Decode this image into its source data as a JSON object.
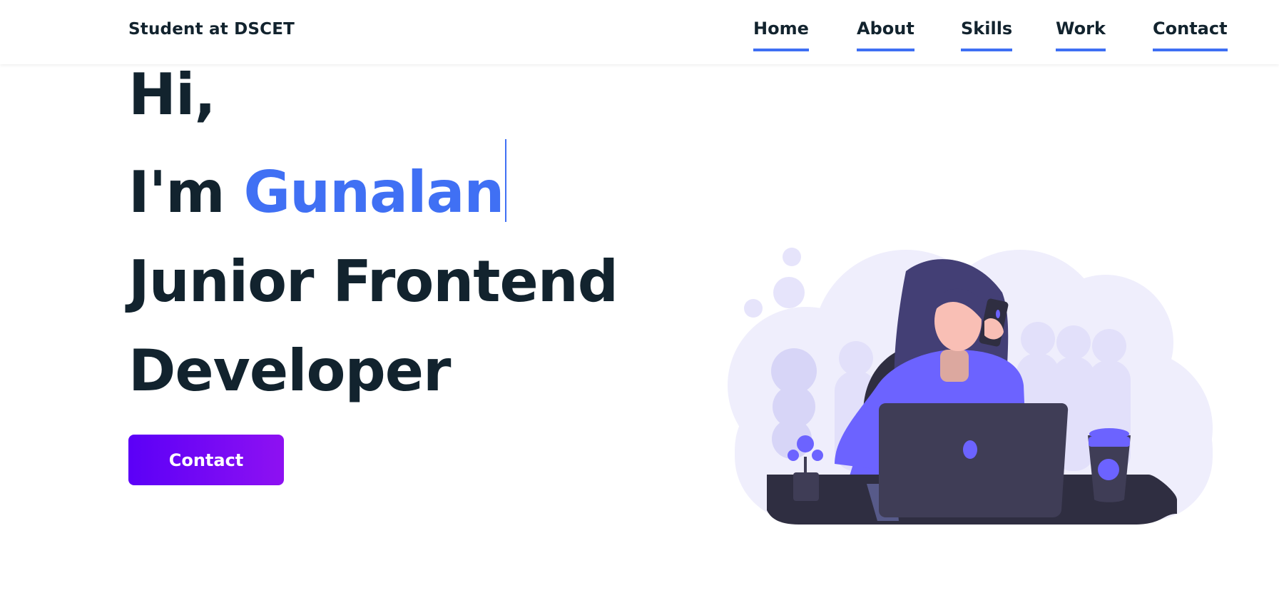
{
  "header": {
    "brand": "Student at DSCET",
    "nav": [
      {
        "id": "home",
        "label": "Home"
      },
      {
        "id": "about",
        "label": "About"
      },
      {
        "id": "skills",
        "label": "Skills"
      },
      {
        "id": "work",
        "label": "Work"
      },
      {
        "id": "contact",
        "label": "Contact"
      }
    ]
  },
  "hero": {
    "greeting": "Hi,",
    "intro_prefix": "I'm ",
    "name": "Gunalan",
    "role_line1": "Junior Frontend",
    "role_line2": "Developer",
    "cta_label": "Contact"
  },
  "colors": {
    "accent": "#4070f4",
    "text": "#12232e",
    "button_start": "#5b00f7",
    "button_end": "#8e11f2",
    "illustration_purple": "#6c63ff"
  },
  "illustration": {
    "icon": "woman-on-phone-at-laptop-illustration"
  }
}
